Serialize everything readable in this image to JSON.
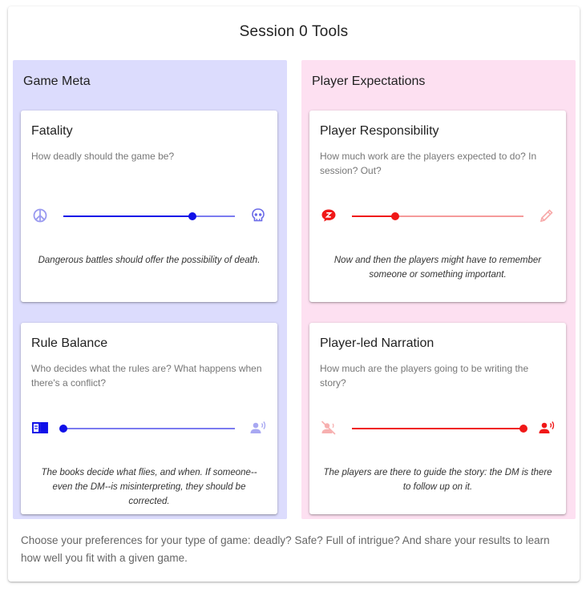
{
  "page": {
    "title": "Session 0 Tools"
  },
  "columns": [
    {
      "title": "Game Meta",
      "colors": {
        "accent": "#1010e8",
        "rest": "#7b7bf0",
        "icon_dim": "#9a9af0"
      },
      "cards": [
        {
          "title": "Fatality",
          "question": "How deadly should the game be?",
          "left_icon": "peace-icon",
          "right_icon": "skull-icon",
          "value": 0.75,
          "description": "Dangerous battles should offer the possibility of death."
        },
        {
          "title": "Rule Balance",
          "question": "Who decides what the rules are? What happens when there's a conflict?",
          "left_icon": "open-book-icon",
          "right_icon": "speaking-person-icon",
          "value": 0.0,
          "description": "The books decide what flies, and when. If someone--even the DM--is misinterpreting, they should be corrected."
        }
      ]
    },
    {
      "title": "Player Expectations",
      "colors": {
        "accent": "#f01818",
        "rest": "#f59a9a",
        "icon_dim": "#f7a8a8"
      },
      "cards": [
        {
          "title": "Player Responsibility",
          "question": "How much work are the players expected to do? In session? Out?",
          "left_icon": "sleep-bubble-icon",
          "right_icon": "pencil-icon",
          "value": 0.25,
          "description": "Now and then the players might have to remember someone or something important."
        },
        {
          "title": "Player-led Narration",
          "question": "How much are the players going to be writing the story?",
          "left_icon": "voice-off-icon",
          "right_icon": "speaking-person-icon",
          "value": 1.0,
          "description": "The players are there to guide the story: the DM is there to follow up on it."
        }
      ]
    }
  ],
  "footer": {
    "text": "Choose your preferences for your type of game: deadly? Safe? Full of intrigue? And share your results to learn how well you fit with a given game."
  }
}
